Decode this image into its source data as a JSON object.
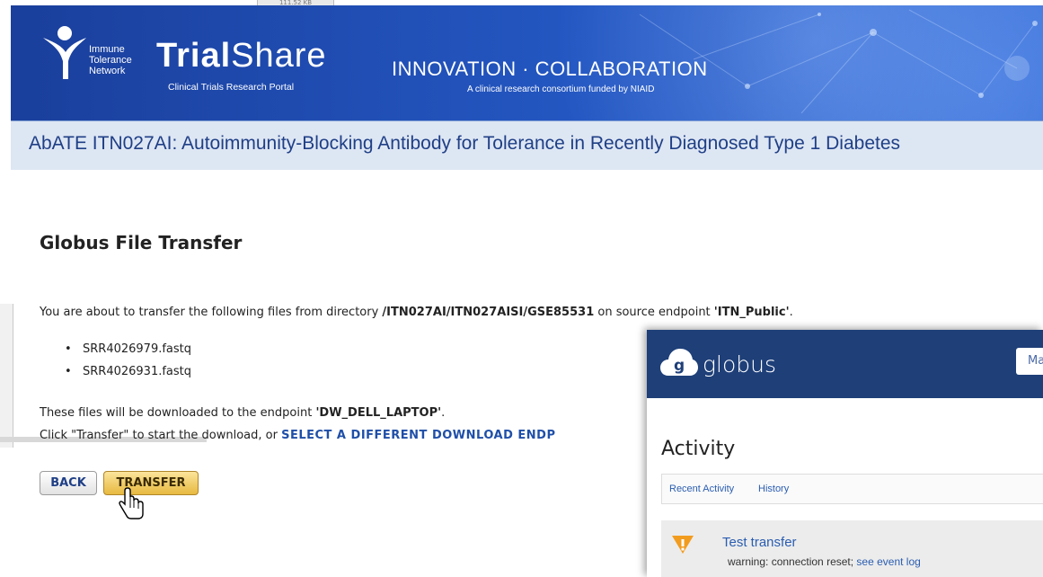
{
  "background": {
    "file_size": "111.52 KB"
  },
  "header": {
    "logo_word1": "Immune",
    "logo_word2": "Tolerance",
    "logo_word3": "Network",
    "logo_trial": "Trial",
    "logo_share": "Share",
    "logo_sub": "Clinical Trials Research Portal",
    "tagline": "INNOVATION · COLLABORATION",
    "tagline_sub": "A clinical research consortium funded by NIAID"
  },
  "study": {
    "title": "AbATE ITN027AI: Autoimmunity-Blocking Antibody for Tolerance in Recently Diagnosed Type 1 Diabetes"
  },
  "transfer": {
    "heading": "Globus File Transfer",
    "intro_prefix": "You are about to transfer the following files from directory ",
    "directory": "/ITN027AI/ITN027AISI/GSE85531",
    "intro_middle": " on source endpoint ",
    "source_endpoint": "'ITN_Public'",
    "intro_suffix": ".",
    "files": [
      "SRR4026979.fastq",
      "SRR4026931.fastq"
    ],
    "dest_prefix": "These files will be downloaded to the endpoint ",
    "dest_endpoint": "'DW_DELL_LAPTOP'",
    "dest_suffix": ".",
    "click_prefix": "Click \"Transfer\" to start the download, or ",
    "select_link": "SELECT A DIFFERENT DOWNLOAD ENDP",
    "back_label": "BACK",
    "transfer_label": "TRANSFER"
  },
  "globus": {
    "brand": "globus",
    "menu_label": "Ma",
    "heading": "Activity",
    "tabs": [
      "Recent Activity",
      "History"
    ],
    "activity": {
      "title": "Test transfer",
      "status_prefix": "warning: connection reset; ",
      "event_log_link": "see event log"
    }
  },
  "colors": {
    "header_blue": "#2457c2",
    "globus_navy": "#1e3f78",
    "transfer_gold": "#e7b940",
    "link_blue": "#1f4fa8"
  }
}
